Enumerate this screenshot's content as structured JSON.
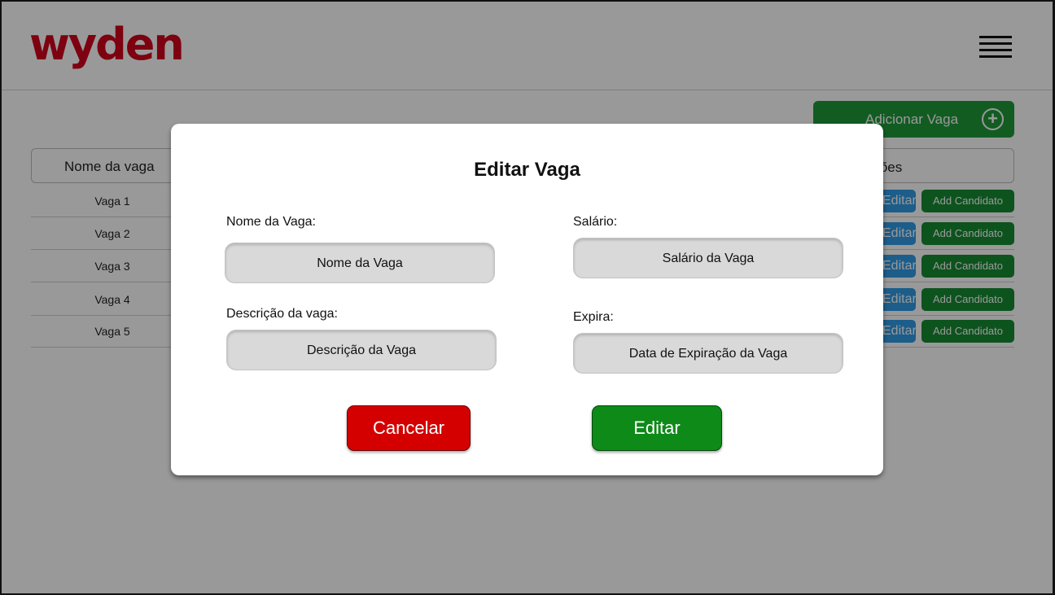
{
  "header": {
    "logo_text": "wyden",
    "menu_icon": "hamburger-menu-icon"
  },
  "toolbar": {
    "add_label": "Adicionar Vaga",
    "add_icon": "plus-circle-icon"
  },
  "table": {
    "headers": [
      "Nome da vaga",
      "Ações"
    ],
    "rows": [
      {
        "name": "Vaga 1",
        "edit_label": "Editar",
        "add_candidate_label": "Add Candidato"
      },
      {
        "name": "Vaga 2",
        "edit_label": "Editar",
        "add_candidate_label": "Add Candidato"
      },
      {
        "name": "Vaga 3",
        "edit_label": "Editar",
        "add_candidate_label": "Add Candidato"
      },
      {
        "name": "Vaga 4",
        "edit_label": "Editar",
        "add_candidate_label": "Add Candidato"
      },
      {
        "name": "Vaga 5",
        "edit_label": "Editar",
        "add_candidate_label": "Add Candidato"
      }
    ]
  },
  "modal": {
    "title": "Editar Vaga",
    "fields": {
      "nome": {
        "label": "Nome da Vaga:",
        "placeholder": "Nome da Vaga"
      },
      "salario": {
        "label": "Salário:",
        "placeholder": "Salário da Vaga"
      },
      "descricao": {
        "label": "Descrição da vaga:",
        "placeholder": "Descrição da Vaga"
      },
      "expira": {
        "label": "Expira:",
        "placeholder": "Data de Expiração da Vaga"
      }
    },
    "cancel_label": "Cancelar",
    "submit_label": "Editar"
  },
  "colors": {
    "brand": "#d0021b",
    "cancel": "#d40000",
    "submit": "#0e8a18",
    "add_button": "#1f9a3a",
    "edit_button": "#2f9be6",
    "candidate_button": "#168a33"
  }
}
